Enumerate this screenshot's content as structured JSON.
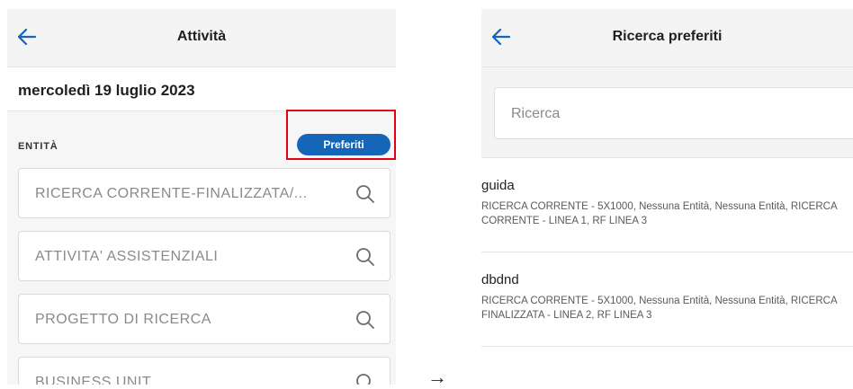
{
  "left_screen": {
    "header": {
      "title": "Attività"
    },
    "date": "mercoledì 19 luglio 2023",
    "section_label": "ENTITÀ",
    "favorites_button": "Preferiti",
    "highlight_color": "#e3000f",
    "accent_color": "#1565b8",
    "entity_fields": [
      {
        "placeholder": "RICERCA CORRENTE-FINALIZZATA/..."
      },
      {
        "placeholder": "ATTIVITA' ASSISTENZIALI"
      },
      {
        "placeholder": "PROGETTO DI RICERCA"
      },
      {
        "placeholder": "BUSINESS UNIT"
      }
    ]
  },
  "transition_arrow": "→",
  "right_screen": {
    "header": {
      "title": "Ricerca preferiti"
    },
    "search": {
      "placeholder": "Ricerca"
    },
    "favorites": [
      {
        "name": "guida",
        "description": "RICERCA CORRENTE - 5X1000, Nessuna Entità, Nessuna Entità, RICERCA CORRENTE - LINEA 1, RF LINEA 3"
      },
      {
        "name": "dbdnd",
        "description": "RICERCA CORRENTE - 5X1000, Nessuna Entità, Nessuna Entità, RICERCA FINALIZZATA - LINEA 2, RF LINEA 3"
      }
    ]
  }
}
